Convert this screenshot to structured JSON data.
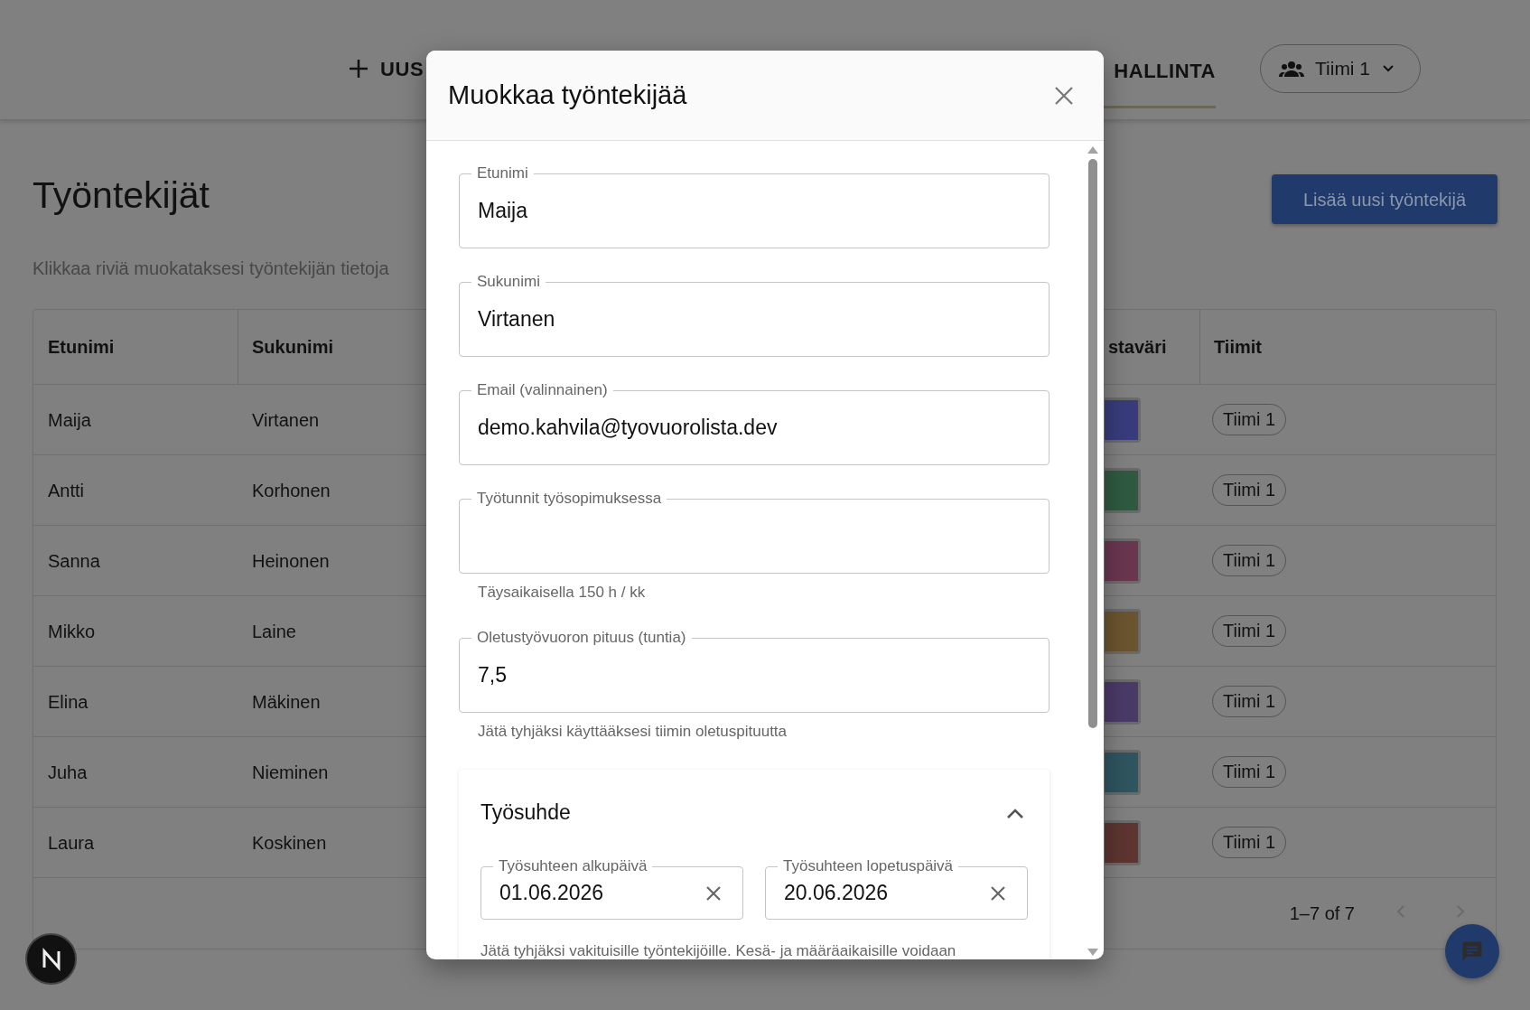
{
  "header": {
    "new_button": "UUS",
    "nav_tab": {
      "label": "HALLINTA",
      "selected": true
    },
    "team_select": "Tiimi 1"
  },
  "page": {
    "title": "Työntekijät",
    "subtitle": "Klikkaa riviä muokataksesi työntekijän tietoja",
    "add_button": "Lisää uusi työntekijä"
  },
  "table": {
    "columns": [
      "Etunimi",
      "Sukunimi",
      "staväri",
      "Tiimit"
    ],
    "rows": [
      {
        "first_name": "Maija",
        "last_name": "Virtanen",
        "color": "#383c7c",
        "team": "Tiimi 1"
      },
      {
        "first_name": "Antti",
        "last_name": "Korhonen",
        "color": "#2f5a40",
        "team": "Tiimi 1"
      },
      {
        "first_name": "Sanna",
        "last_name": "Heinonen",
        "color": "#6a3650",
        "team": "Tiimi 1"
      },
      {
        "first_name": "Mikko",
        "last_name": "Laine",
        "color": "#6b5530",
        "team": "Tiimi 1"
      },
      {
        "first_name": "Elina",
        "last_name": "Mäkinen",
        "color": "#4a3a68",
        "team": "Tiimi 1"
      },
      {
        "first_name": "Juha",
        "last_name": "Nieminen",
        "color": "#2f5560",
        "team": "Tiimi 1"
      },
      {
        "first_name": "Laura",
        "last_name": "Koskinen",
        "color": "#5e3530",
        "team": "Tiimi 1"
      }
    ],
    "pagination": "1–7 of 7"
  },
  "dialog": {
    "title": "Muokkaa työntekijää",
    "fields": [
      {
        "label": "Etunimi",
        "value": "Maija"
      },
      {
        "label": "Sukunimi",
        "value": "Virtanen"
      },
      {
        "label": "Email (valinnainen)",
        "value": "demo.kahvila@tyovuorolista.dev"
      },
      {
        "label": "Työtunnit työsopimuksessa",
        "helper": "Täysaikaisella 150 h / kk"
      },
      {
        "label": "Oletustyövuoron pituus (tuntia)",
        "value": "7,5",
        "helper": "Jätä tyhjäksi käyttääksesi tiimin oletuspituutta"
      }
    ],
    "section": {
      "title": "Työsuhde",
      "expanded": true,
      "date_fields": [
        {
          "label": "Työsuhteen alkupäivä",
          "value": "01.06.2026"
        },
        {
          "label": "Työsuhteen lopetuspäivä",
          "value": "20.06.2026"
        }
      ],
      "helper": "Jätä tyhjäksi vakituisille työntekijöille. Kesä- ja määräaikaisille voidaan"
    }
  }
}
